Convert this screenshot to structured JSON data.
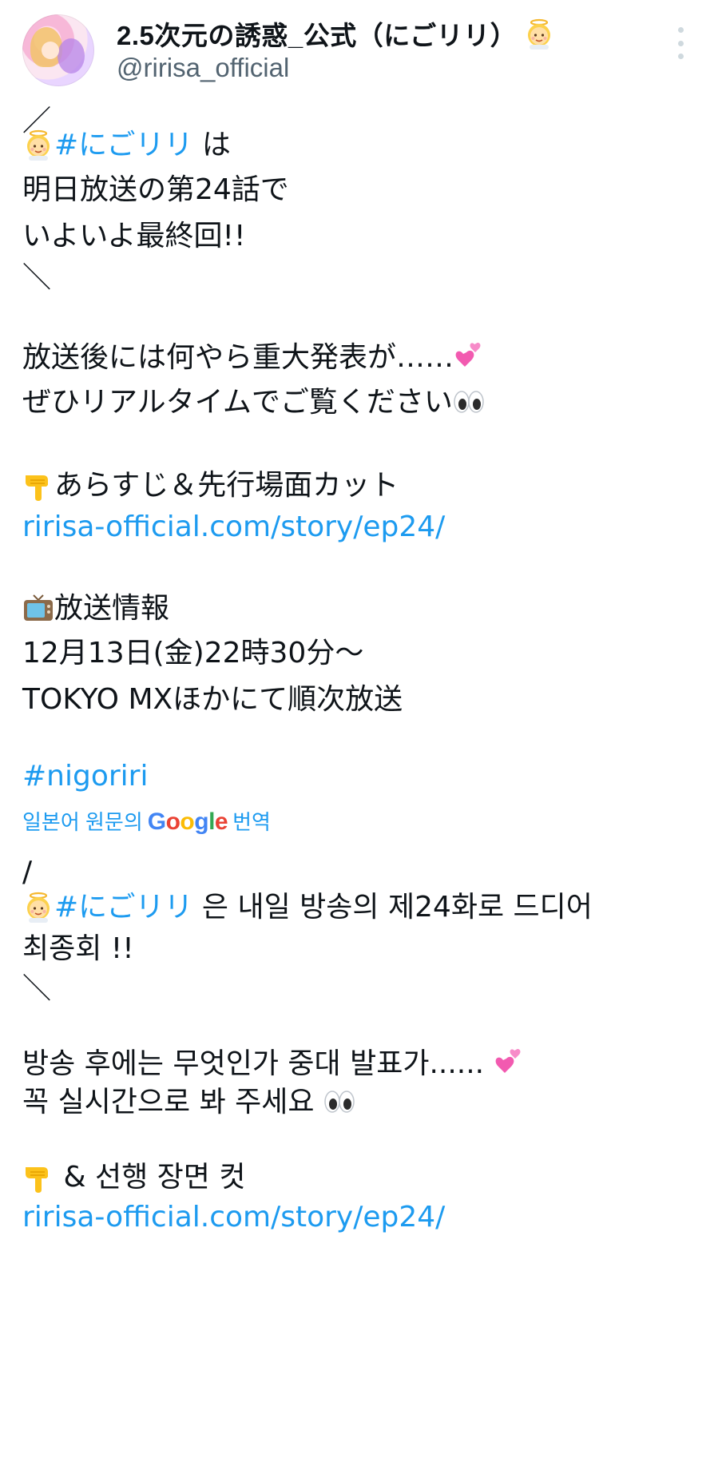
{
  "author": {
    "display_name": "2.5次元の誘惑_公式（にごリリ）",
    "name_emoji": "baby-angel-icon",
    "handle": "@ririsa_official"
  },
  "original": {
    "line1": "／",
    "hashtag1": "#にごリリ",
    "line2_suffix": " は",
    "line3": "明日放送の第24話で",
    "line4": "いよいよ最終回!!",
    "line5": "＼",
    "line6": "放送後には何やら重大発表が……",
    "line7": "ぜひリアルタイムでご覧ください",
    "line8": "あらすじ＆先行場面カット",
    "link1": "ririsa-official.com/story/ep24/",
    "line9": "放送情報",
    "line10": "12月13日(金)22時30分～",
    "line11": "TOKYO MXほかにて順次放送",
    "hashtag2": "#nigoriri"
  },
  "translation_bar": {
    "prefix": "일본어 원문의",
    "google": [
      "G",
      "o",
      "o",
      "g",
      "l",
      "e"
    ],
    "suffix": "번역"
  },
  "translated": {
    "line1": "/",
    "hashtag1": "#にごリリ",
    "line2_suffix": " 은 내일 방송의 제24화로 드디어",
    "line3": "최종회 !!",
    "line4": "＼",
    "line5": "방송 후에는 무엇인가 중대 발표가...... ",
    "line6": "꼭 실시간으로 봐 주세요 ",
    "line7": " & 선행 장면 컷",
    "link1": "ririsa-official.com/story/ep24/"
  },
  "colors": {
    "link": "#1d9bf0",
    "text": "#0f1419",
    "muted": "#536471"
  },
  "icons": {
    "baby_angel": "baby-angel-icon",
    "two_hearts": "two-hearts-icon",
    "eyes": "eyes-icon",
    "pointing_down": "backhand-index-pointing-down-icon",
    "television": "television-icon"
  }
}
